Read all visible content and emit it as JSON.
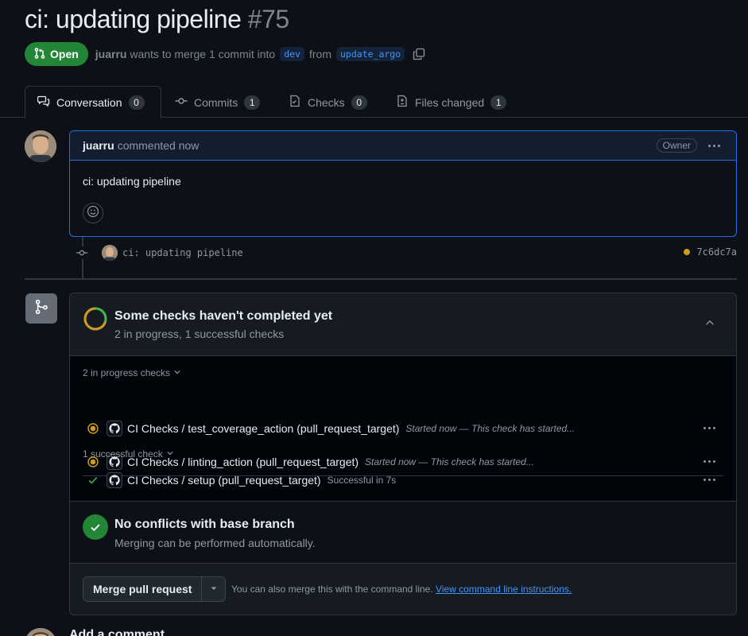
{
  "pr": {
    "title": "ci: updating pipeline",
    "number": "#75",
    "state": "Open",
    "author": "juarru",
    "merge_text": "wants to merge 1 commit into",
    "base_branch": "dev",
    "from_text": "from",
    "head_branch": "update_argo"
  },
  "tabs": [
    {
      "label": "Conversation",
      "count": "0"
    },
    {
      "label": "Commits",
      "count": "1"
    },
    {
      "label": "Checks",
      "count": "0"
    },
    {
      "label": "Files changed",
      "count": "1"
    }
  ],
  "comment": {
    "author": "juarru",
    "time_text": "commented now",
    "role_badge": "Owner",
    "body": "ci: updating pipeline"
  },
  "commit": {
    "message": "ci: updating pipeline",
    "sha": "7c6dc7a"
  },
  "checks": {
    "title": "Some checks haven't completed yet",
    "subtitle": "2 in progress, 1 successful checks",
    "in_progress_label": "2 in progress checks",
    "in_progress": [
      {
        "name": "CI Checks / linting_action (pull_request_target)",
        "desc": "Started now — This check has started..."
      },
      {
        "name": "CI Checks / test_coverage_action (pull_request_target)",
        "desc": "Started now — This check has started..."
      }
    ],
    "successful_label": "1 successful check",
    "successful": [
      {
        "name": "CI Checks / setup (pull_request_target)",
        "desc": "Successful in 7s"
      }
    ]
  },
  "conflicts": {
    "title": "No conflicts with base branch",
    "subtitle": "Merging can be performed automatically."
  },
  "merge": {
    "button_label": "Merge pull request",
    "hint": "You can also merge this with the command line.",
    "link": "View command line instructions."
  },
  "footer": {
    "add_comment": "Add a comment"
  },
  "colors": {
    "open_green": "#238636",
    "accent_blue": "#1f6feb",
    "pending_amber": "#d29922",
    "success_green": "#3fb950"
  }
}
